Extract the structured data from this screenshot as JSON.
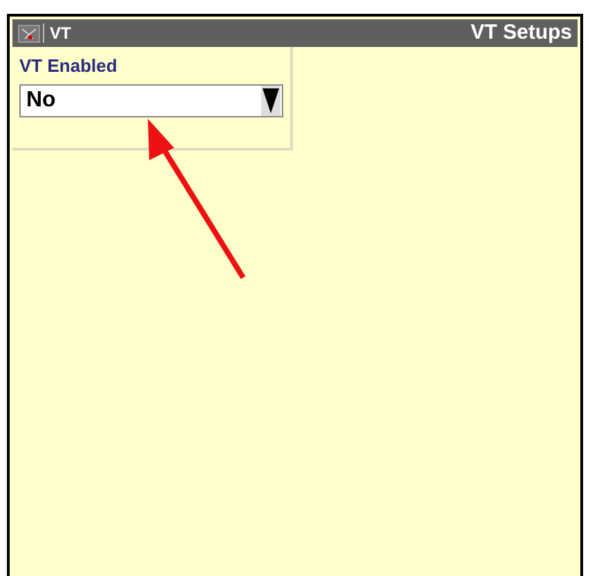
{
  "title_bar": {
    "app_label": "VT",
    "screen_title": "VT Setups"
  },
  "setting": {
    "label": "VT Enabled",
    "value": "No"
  }
}
